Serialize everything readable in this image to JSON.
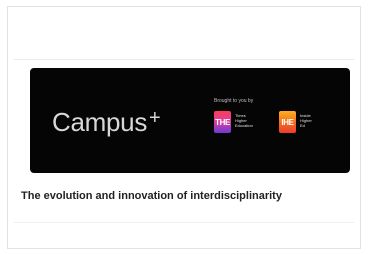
{
  "banner": {
    "brand_name": "Campus",
    "brand_superscript": "+",
    "brought_by": "Brought to you by",
    "the_logo_text": "THE",
    "the_name_lines": [
      "Times",
      "Higher",
      "Education"
    ],
    "ihe_logo_text": "IHE",
    "ihe_name_lines": [
      "Inside",
      "Higher",
      "Ed"
    ],
    "colors": {
      "background": "#050505",
      "the_logo": "#d73fa1",
      "ihe_logo": "#f26a1f"
    }
  },
  "article": {
    "title": "The evolution and innovation of interdisciplinarity"
  }
}
